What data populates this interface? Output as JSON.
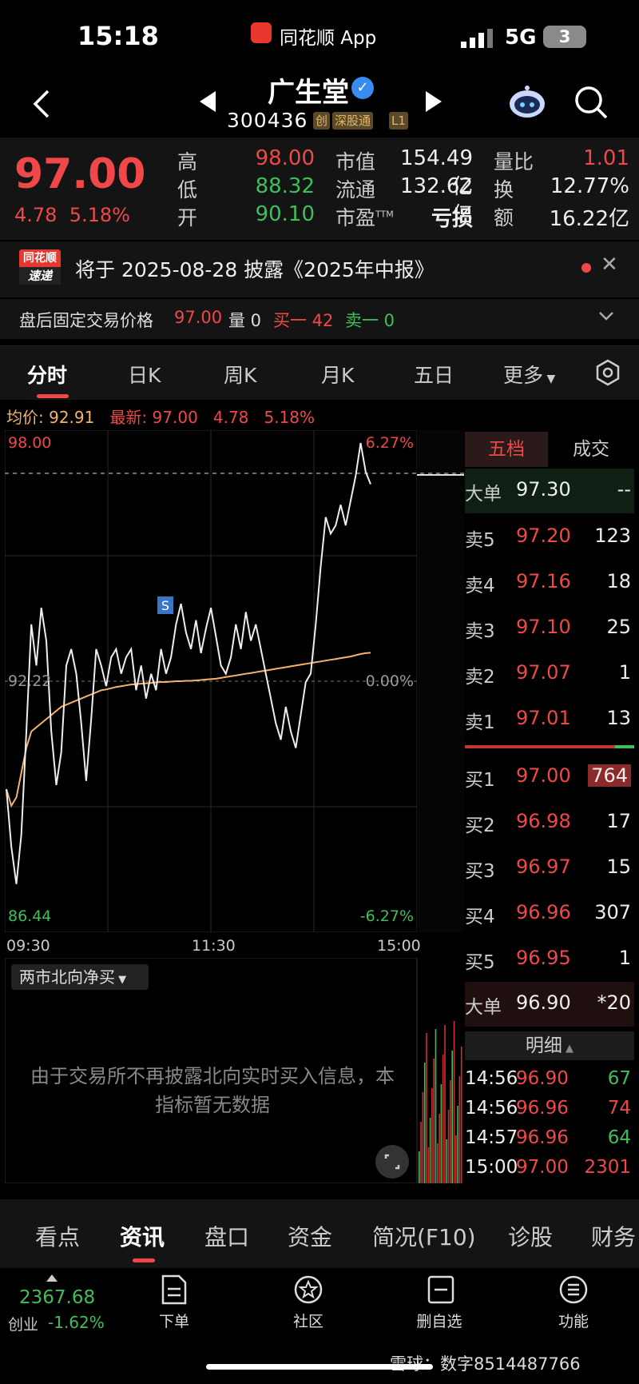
{
  "status_bar": {
    "time": "15:18",
    "app": "同花顺 App",
    "network": "5G",
    "battery": "3"
  },
  "header": {
    "stock_name": "广生堂",
    "stock_code": "300436",
    "tags": [
      "创",
      "深股通",
      "L1"
    ],
    "verified_mark": "✓"
  },
  "quote": {
    "price": "97.00",
    "change": "4.78",
    "change_pct": "5.18%",
    "high_label": "高",
    "high": "98.00",
    "low_label": "低",
    "low": "88.32",
    "open_label": "开",
    "open": "90.10",
    "mcap_label": "市值",
    "mcap": "154.49亿",
    "float_label": "流通",
    "float": "132.62亿",
    "pe_label": "市盈",
    "pe_sup": "TTM",
    "pe": "亏损",
    "vr_label": "量比",
    "vr": "1.01",
    "turnover_label": "换",
    "turnover": "12.77%",
    "amount_label": "额",
    "amount": "16.22亿"
  },
  "notice": {
    "logo_top": "同花顺",
    "logo_bottom": "速递",
    "text": "将于 2025-08-28 披露《2025年中报》",
    "close": "✕"
  },
  "after_hours": {
    "label": "盘后固定交易价格",
    "price": "97.00",
    "volume": "量 0",
    "bid": "买一 42",
    "ask": "卖一 0"
  },
  "chart_tabs": [
    "分时",
    "日K",
    "周K",
    "月K",
    "五日",
    "更多"
  ],
  "avg_line": {
    "avg": "均价: 92.91",
    "latest": "最新: 97.00",
    "chg": "4.78",
    "pct": "5.18%"
  },
  "chart_data": {
    "type": "line",
    "y_top": "98.00",
    "y_bottom": "86.44",
    "y_mid": "92.22",
    "pct_top": "6.27%",
    "pct_mid": "0.00%",
    "pct_bottom": "-6.27%",
    "ylim": [
      86.44,
      98.0
    ],
    "x_ticks": [
      "09:30",
      "11:30",
      "15:00"
    ],
    "signal_marker": "S",
    "series": [
      {
        "values": [
          89.6,
          88.2,
          87.3,
          88.5,
          91.0,
          93.6,
          92.6,
          94.0,
          93.2,
          91.0,
          89.7,
          90.5,
          92.6,
          93.0,
          92.4,
          91.2,
          89.8,
          91.3,
          93.0,
          92.6,
          92.1,
          92.8,
          93.0,
          92.4,
          92.8,
          93.0,
          92.0,
          92.6,
          91.8,
          92.4,
          92.0,
          93.0,
          92.4,
          92.8,
          93.6,
          94.1,
          93.4,
          93.0,
          93.7,
          92.9,
          93.5,
          94.0,
          93.3,
          92.6,
          92.4,
          92.8,
          93.6,
          93.0,
          93.9,
          93.2,
          93.6,
          93.0,
          92.4,
          91.8,
          91.2,
          90.8,
          91.6,
          91.0,
          90.6,
          91.4,
          92.2,
          92.4,
          93.6,
          95.0,
          96.2,
          95.8,
          96.0,
          96.5,
          96.0,
          96.6,
          97.2,
          98.0,
          97.3,
          97.0
        ]
      },
      {
        "name": "均价",
        "values": [
          89.6,
          89.2,
          89.4,
          90.0,
          90.6,
          91.0,
          91.1,
          91.2,
          91.3,
          91.4,
          91.5,
          91.6,
          91.65,
          91.7,
          91.75,
          91.8,
          91.85,
          91.9,
          91.95,
          92.0,
          92.02,
          92.05,
          92.08,
          92.1,
          92.12,
          92.14,
          92.15,
          92.16,
          92.17,
          92.18,
          92.19,
          92.2,
          92.2,
          92.21,
          92.22,
          92.22,
          92.23,
          92.23,
          92.24,
          92.25,
          92.26,
          92.27,
          92.28,
          92.3,
          92.32,
          92.34,
          92.36,
          92.38,
          92.4,
          92.42,
          92.44,
          92.46,
          92.48,
          92.5,
          92.52,
          92.54,
          92.56,
          92.58,
          92.6,
          92.62,
          92.64,
          92.66,
          92.68,
          92.7,
          92.72,
          92.74,
          92.76,
          92.78,
          92.8,
          92.82,
          92.85,
          92.88,
          92.9,
          92.91
        ]
      }
    ]
  },
  "lower_panel": {
    "select": "两市北向净买",
    "message_line1": "由于交易所不再披露北向实时买入信息，本",
    "message_line2": "指标暂无数据"
  },
  "order_book": {
    "tab1": "五档",
    "tab2": "成交",
    "big_ask": {
      "label": "大单",
      "price": "97.30",
      "qty": "--"
    },
    "asks": [
      {
        "label": "卖5",
        "price": "97.20",
        "qty": "123"
      },
      {
        "label": "卖4",
        "price": "97.16",
        "qty": "18"
      },
      {
        "label": "卖3",
        "price": "97.10",
        "qty": "25"
      },
      {
        "label": "卖2",
        "price": "97.07",
        "qty": "1"
      },
      {
        "label": "卖1",
        "price": "97.01",
        "qty": "13"
      }
    ],
    "bids": [
      {
        "label": "买1",
        "price": "97.00",
        "qty": "764"
      },
      {
        "label": "买2",
        "price": "96.98",
        "qty": "17"
      },
      {
        "label": "买3",
        "price": "96.97",
        "qty": "15"
      },
      {
        "label": "买4",
        "price": "96.96",
        "qty": "307"
      },
      {
        "label": "买5",
        "price": "96.95",
        "qty": "1"
      }
    ],
    "big_bid": {
      "label": "大单",
      "price": "96.90",
      "qty": "*20"
    },
    "detail_label": "明细",
    "trades": [
      {
        "time": "14:56",
        "price": "96.90",
        "qty": "67",
        "dir": "sell"
      },
      {
        "time": "14:56",
        "price": "96.96",
        "qty": "74",
        "dir": "buy"
      },
      {
        "time": "14:57",
        "price": "96.96",
        "qty": "64",
        "dir": "sell"
      },
      {
        "time": "15:00",
        "price": "97.00",
        "qty": "2301",
        "dir": "buy"
      }
    ]
  },
  "info_tabs": [
    "看点",
    "资讯",
    "盘口",
    "资金",
    "简况(F10)",
    "诊股",
    "财务"
  ],
  "bottom_nav": {
    "index_value": "2367.68",
    "index_name": "创业",
    "index_chg": "-1.62%",
    "items": [
      "下单",
      "社区",
      "删自选",
      "功能"
    ]
  },
  "watermark": "雪球：数字8514487766",
  "colors": {
    "up": "#f04848",
    "down": "#3fbf5a",
    "avg": "#f5b26b",
    "bg": "#000000"
  }
}
